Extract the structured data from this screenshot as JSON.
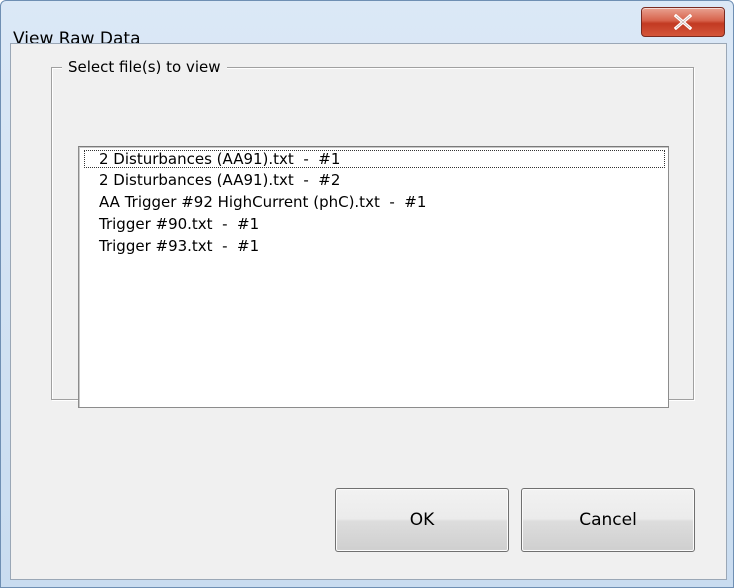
{
  "window": {
    "title": "View Raw Data",
    "close_icon": "close-icon"
  },
  "group": {
    "legend": "Select file(s) to view"
  },
  "files": [
    {
      "label": "2 Disturbances (AA91).txt  -  #1",
      "focused": true
    },
    {
      "label": "2 Disturbances (AA91).txt  -  #2",
      "focused": false
    },
    {
      "label": "AA Trigger #92 HighCurrent (phC).txt  -  #1",
      "focused": false
    },
    {
      "label": "Trigger #90.txt  -  #1",
      "focused": false
    },
    {
      "label": "Trigger #93.txt  -  #1",
      "focused": false
    }
  ],
  "buttons": {
    "ok_label": "OK",
    "cancel_label": "Cancel"
  },
  "colors": {
    "close_button": "#c23a22",
    "dialog_face": "#f0f0f0",
    "frame": "#c9dcf0"
  }
}
